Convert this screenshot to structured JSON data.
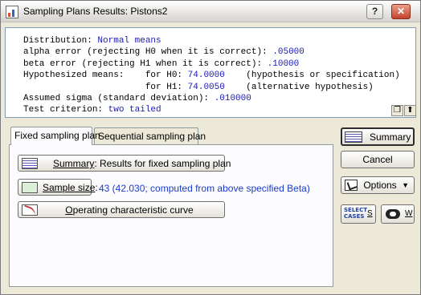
{
  "window": {
    "title": "Sampling Plans Results: Pistons2",
    "help_label": "?",
    "close_label": "✕"
  },
  "results": {
    "lines": [
      {
        "label": "Distribution: ",
        "value": "Normal means"
      },
      {
        "label": "alpha error (rejecting H0 when it is correct): ",
        "value": ".05000"
      },
      {
        "label": "beta error (rejecting H1 when it is correct): ",
        "value": ".10000"
      },
      {
        "label": "Hypothesized means:    for H0: ",
        "value": "74.0000",
        "note": "    (hypothesis or specification)"
      },
      {
        "label": "                       for H1: ",
        "value": "74.0050",
        "note": "    (alternative hypothesis)"
      },
      {
        "label": "Assumed sigma (standard deviation): ",
        "value": ".010000"
      },
      {
        "label": "Test criterion: ",
        "value": "two tailed"
      }
    ]
  },
  "tabs": [
    {
      "label": "Fixed sampling plan"
    },
    {
      "label": "Sequential sampling plan"
    }
  ],
  "panel": {
    "summary_prefix": "Summary",
    "summary_rest": ":  Results for fixed sampling plan",
    "sample_size_prefix": "Sample size",
    "sample_size_suffix": ":",
    "sample_size_value": "43 (42.030; computed from above specified Beta)",
    "occ_prefix": "O",
    "occ_rest": "perating characteristic curve"
  },
  "right": {
    "summary": "Summary",
    "cancel": "Cancel",
    "options": "Options",
    "select_cases": "SELECT\nCASES",
    "select_key": "S",
    "weight_key": "W"
  },
  "icons": {
    "app": "chart-icon",
    "copy": "copy-icon",
    "up": "arrow-up-icon"
  }
}
